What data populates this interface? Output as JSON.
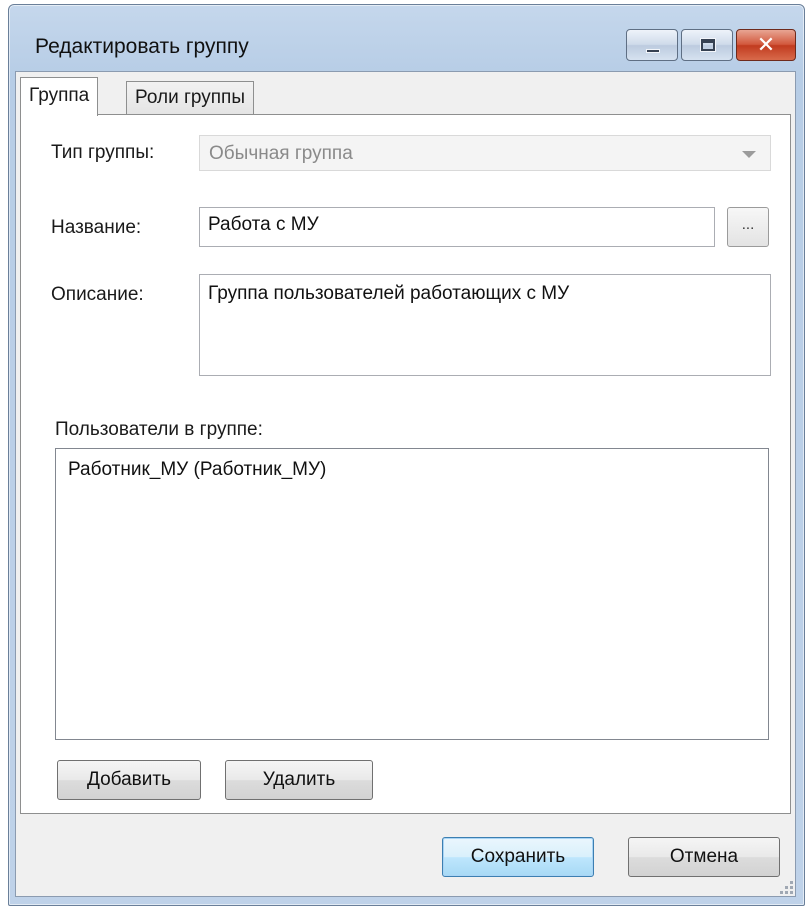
{
  "window": {
    "title": "Редактировать группу",
    "controls": [
      "minimize-icon",
      "maximize-icon",
      "close-icon"
    ],
    "close_glyph": "✕"
  },
  "tabs": [
    {
      "label": "Группа",
      "active": true
    },
    {
      "label": "Роли группы",
      "active": false
    }
  ],
  "form": {
    "type_label": "Тип группы:",
    "type_value": "Обычная группа",
    "name_label": "Название:",
    "name_value": "Работа с МУ",
    "browse_label": "...",
    "description_label": "Описание:",
    "description_value": "Группа пользователей работающих с МУ",
    "users_label": "Пользователи в группе:",
    "users": [
      "Работник_МУ (Работник_МУ)"
    ]
  },
  "buttons": {
    "add": "Добавить",
    "remove": "Удалить",
    "save": "Сохранить",
    "cancel": "Отмена"
  },
  "colors": {
    "title_bar": "#b7cde6",
    "close_button": "#c13b1f",
    "default_button": "#3c7fb1"
  }
}
